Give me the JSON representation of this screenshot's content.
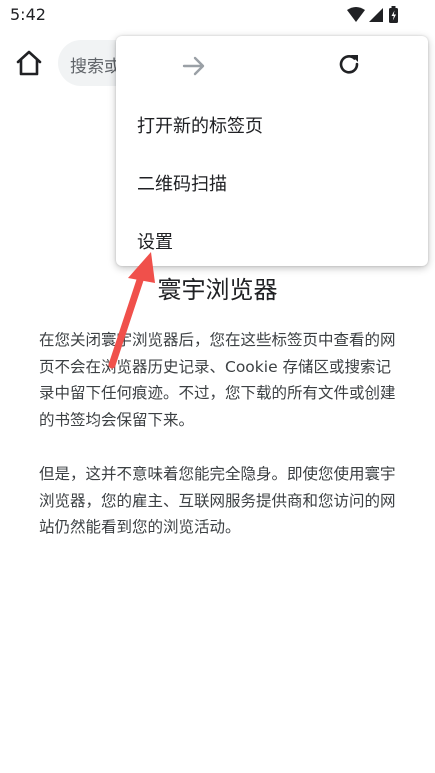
{
  "status_bar": {
    "time": "5:42"
  },
  "toolbar": {
    "omnibox_text": "搜索或输入网址"
  },
  "content": {
    "heading": "寰宇浏览器",
    "paragraph1": "在您关闭寰宇浏览器后，您在这些标签页中查看的网页不会在浏览器历史记录、Cookie 存储区或搜索记录中留下任何痕迹。不过，您下载的所有文件或创建的书签均会保留下来。",
    "paragraph2": "但是，这并不意味着您能完全隐身。即使您使用寰宇浏览器，您的雇主、互联网服务提供商和您访问的网站仍然能看到您的浏览活动。"
  },
  "menu": {
    "icons": [
      "forward-icon",
      "reload-icon"
    ],
    "items": [
      {
        "label": "打开新的标签页"
      },
      {
        "label": "二维码扫描"
      },
      {
        "label": "设置"
      }
    ]
  },
  "annotation": {
    "arrow_color": "#f0504b"
  },
  "colors": {
    "omnibox_bg": "#f1f3f4",
    "text_primary": "#202124",
    "text_secondary": "#3c4043",
    "icon_disabled": "#9aa0a6"
  }
}
